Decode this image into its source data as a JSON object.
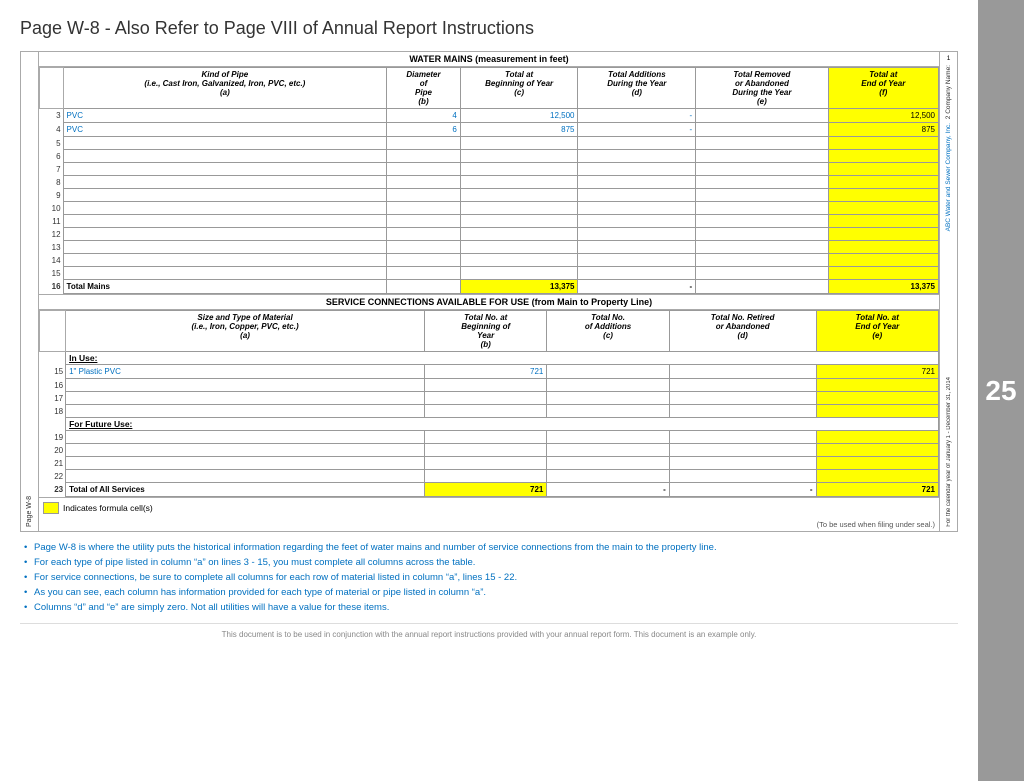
{
  "page": {
    "title": "Page W-8 - Also Refer to Page VIII of Annual Report Instructions",
    "page_number": "25"
  },
  "water_mains": {
    "section_title": "WATER MAINS (measurement in feet)",
    "columns": [
      {
        "label": "Kind of Pipe",
        "sub": "(i.e., Cast Iron, Galvanized, Iron, PVC, etc.)",
        "col_letter": "(a)"
      },
      {
        "label": "Diameter of Pipe",
        "col_letter": "(b)"
      },
      {
        "label": "Total at Beginning of Year",
        "col_letter": "(c)"
      },
      {
        "label": "Total Additions During the Year",
        "col_letter": "(d)"
      },
      {
        "label": "Total Removed or Abandoned During the Year",
        "col_letter": "(e)"
      },
      {
        "label": "Total at End of Year",
        "col_letter": "(f)"
      }
    ],
    "rows": [
      {
        "num": "3",
        "pipe": "PVC",
        "diameter": "4",
        "beginning": "12,500",
        "additions": "-",
        "removed": "",
        "end": "12,500",
        "highlight_end": true
      },
      {
        "num": "4",
        "pipe": "PVC",
        "diameter": "6",
        "beginning": "875",
        "additions": "-",
        "removed": "",
        "end": "875",
        "highlight_end": true
      },
      {
        "num": "5",
        "pipe": "",
        "diameter": "",
        "beginning": "",
        "additions": "",
        "removed": "",
        "end": "",
        "highlight_end": true
      },
      {
        "num": "6",
        "pipe": "",
        "diameter": "",
        "beginning": "",
        "additions": "",
        "removed": "",
        "end": "",
        "highlight_end": true
      },
      {
        "num": "7",
        "pipe": "",
        "diameter": "",
        "beginning": "",
        "additions": "",
        "removed": "",
        "end": "",
        "highlight_end": true
      },
      {
        "num": "8",
        "pipe": "",
        "diameter": "",
        "beginning": "",
        "additions": "",
        "removed": "",
        "end": "",
        "highlight_end": true
      },
      {
        "num": "9",
        "pipe": "",
        "diameter": "",
        "beginning": "",
        "additions": "",
        "removed": "",
        "end": "",
        "highlight_end": true
      },
      {
        "num": "10",
        "pipe": "",
        "diameter": "",
        "beginning": "",
        "additions": "",
        "removed": "",
        "end": "",
        "highlight_end": true
      },
      {
        "num": "11",
        "pipe": "",
        "diameter": "",
        "beginning": "",
        "additions": "",
        "removed": "",
        "end": "",
        "highlight_end": true
      },
      {
        "num": "12",
        "pipe": "",
        "diameter": "",
        "beginning": "",
        "additions": "",
        "removed": "",
        "end": "",
        "highlight_end": true
      },
      {
        "num": "13",
        "pipe": "",
        "diameter": "",
        "beginning": "",
        "additions": "",
        "removed": "",
        "end": "",
        "highlight_end": true
      },
      {
        "num": "14",
        "pipe": "",
        "diameter": "",
        "beginning": "",
        "additions": "",
        "removed": "",
        "end": "",
        "highlight_end": true
      },
      {
        "num": "15",
        "pipe": "",
        "diameter": "",
        "beginning": "",
        "additions": "",
        "removed": "",
        "end": "",
        "highlight_end": true
      }
    ],
    "total_row": {
      "num": "16",
      "label": "Total Mains",
      "beginning": "13,375",
      "additions": "-",
      "removed": "",
      "end": "13,375"
    }
  },
  "service_connections": {
    "section_title": "SERVICE CONNECTIONS AVAILABLE FOR USE (from Main to Property Line)",
    "columns": [
      {
        "label": "Size and Type of Material",
        "sub": "(i.e., Iron, Copper, PVC, etc.)",
        "col_letter": "(a)"
      },
      {
        "label": "Total No. at Beginning of Year",
        "col_letter": "(b)"
      },
      {
        "label": "Total No. of Additions",
        "col_letter": "(c)"
      },
      {
        "label": "Total No. Retired or Abandoned",
        "col_letter": "(d)"
      },
      {
        "label": "Total No. at End of Year",
        "col_letter": "(e)"
      }
    ],
    "in_use_label": "In Use:",
    "rows_in_use": [
      {
        "num": "15",
        "material": "1\" Plastic PVC",
        "beginning": "721",
        "additions": "",
        "retired": "",
        "end": "721",
        "highlight_end": true
      },
      {
        "num": "16",
        "material": "",
        "beginning": "",
        "additions": "",
        "retired": "",
        "end": "",
        "highlight_end": true
      },
      {
        "num": "17",
        "material": "",
        "beginning": "",
        "additions": "",
        "retired": "",
        "end": "",
        "highlight_end": true
      },
      {
        "num": "18",
        "material": "",
        "beginning": "",
        "additions": "",
        "retired": "",
        "end": "",
        "highlight_end": true
      }
    ],
    "future_use_label": "For Future Use:",
    "rows_future": [
      {
        "num": "19",
        "material": "",
        "beginning": "",
        "additions": "",
        "retired": "",
        "end": "",
        "highlight_end": true
      },
      {
        "num": "20",
        "material": "",
        "beginning": "",
        "additions": "",
        "retired": "",
        "end": "",
        "highlight_end": true
      },
      {
        "num": "21",
        "material": "",
        "beginning": "",
        "additions": "",
        "retired": "",
        "end": "",
        "highlight_end": true
      },
      {
        "num": "22",
        "material": "",
        "beginning": "",
        "additions": "",
        "retired": "",
        "end": "",
        "highlight_end": true
      }
    ],
    "total_row": {
      "num": "23",
      "label": "Total of All Services",
      "beginning": "721",
      "additions": "-",
      "retired": "-",
      "end": "721"
    }
  },
  "sidebar": {
    "company_number": "1",
    "company_name_label": "2 Company Name:",
    "company_name": "ABC Water and Sewer Company, Inc.",
    "calendar_year": "For the calendar year of January 1 - December 31, 2014"
  },
  "legend": {
    "label": "Indicates formula cell(s)"
  },
  "seal_note": "(To be used when filing under seal.)",
  "bullets": [
    "Page W-8 is where the utility puts the historical information regarding the feet of water mains and number of service connections from the main to the property line.",
    "For each type of pipe listed in column “a” on lines 3 - 15, you must complete all columns across the table.",
    "For service connections, be sure to complete all columns for each row of material listed in column “a”, lines 15 - 22.",
    "As you can see, each column has information provided for each type of material or pipe listed in column “a”.",
    "Columns “d” and “e” are simply zero.  Not all utilities will have a value for these items."
  ],
  "footer": "This document is to be used in conjunction with the annual report instructions provided with your annual report form.  This document is an example only."
}
